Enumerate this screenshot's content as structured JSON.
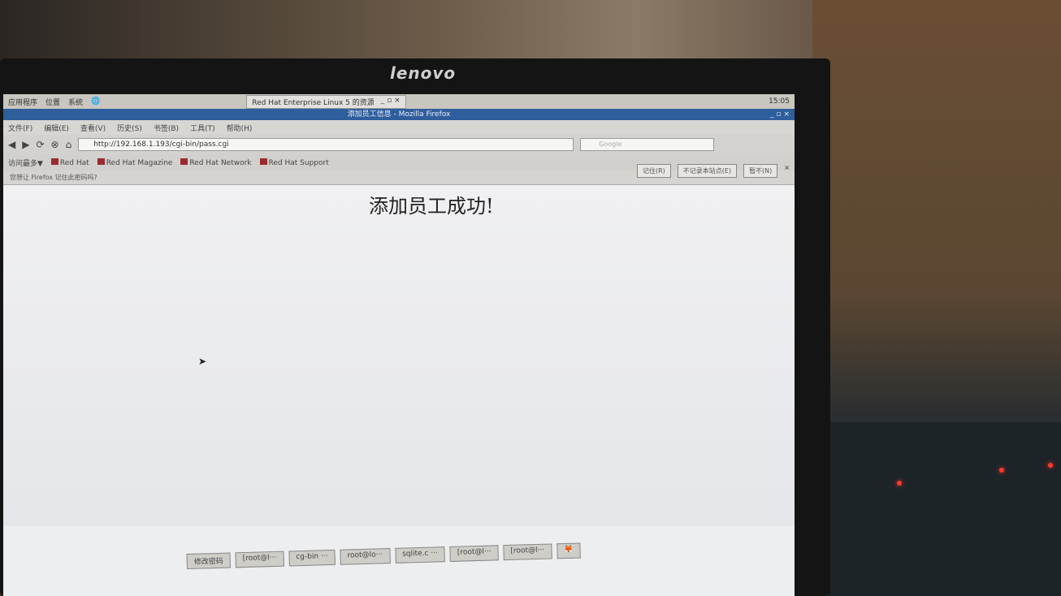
{
  "monitor": {
    "brand": "lenovo"
  },
  "top_panel": {
    "items": [
      "应用程序",
      "位置",
      "系统"
    ],
    "window_tab": "Red Hat Enterprise Linux 5 的资源",
    "clock": "15:05"
  },
  "window": {
    "title": "添加员工信息 - Mozilla Firefox"
  },
  "menu": [
    "文件(F)",
    "编辑(E)",
    "查看(V)",
    "历史(S)",
    "书签(B)",
    "工具(T)",
    "帮助(H)"
  ],
  "nav": {
    "url": "http://192.168.1.193/cgi-bin/pass.cgi",
    "search_placeholder": "Google"
  },
  "bookmarks": [
    "访问最多▼",
    "Red Hat",
    "Red Hat Magazine",
    "Red Hat Network",
    "Red Hat Support"
  ],
  "password_bar": {
    "text": "您想让 Firefox 记住此密码吗?",
    "buttons": [
      "记住(R)",
      "不记录本站点(E)",
      "暂不(N)"
    ]
  },
  "page": {
    "message": "添加员工成功!"
  },
  "taskbar": [
    "修改密码",
    "[root@l···",
    "cg-bin ···",
    "root@lo···",
    "sqlite.c ···",
    "[root@l···",
    "[root@l···"
  ]
}
